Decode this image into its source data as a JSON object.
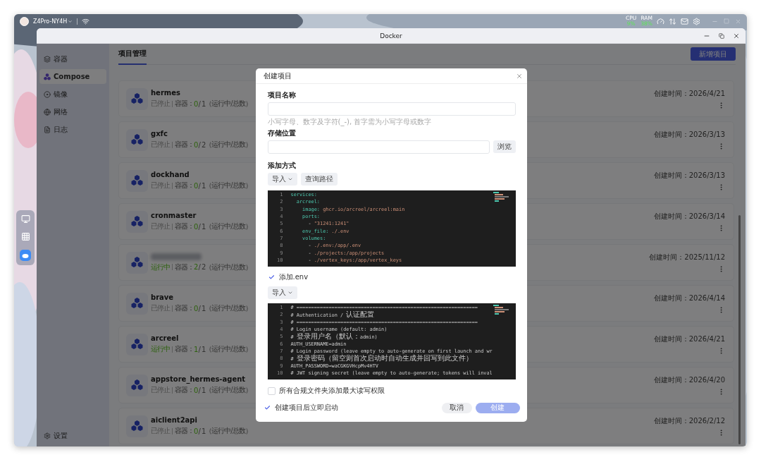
{
  "desktop": {
    "device": "Z4Pro-NY4H",
    "meters": [
      {
        "label": "CPU",
        "value": "9%"
      },
      {
        "label": "RAM",
        "value": "38%"
      }
    ]
  },
  "window": {
    "title": "Docker"
  },
  "sidebar": {
    "items": [
      {
        "label": "容器",
        "kind": "layers",
        "selected": false
      },
      {
        "label": "Compose",
        "kind": "compose",
        "selected": true
      },
      {
        "label": "镜像",
        "kind": "disc",
        "selected": false
      },
      {
        "label": "网络",
        "kind": "globe",
        "selected": false
      },
      {
        "label": "日志",
        "kind": "log",
        "selected": false
      }
    ],
    "footer": "设置"
  },
  "tabs": [
    {
      "label": "项目管理",
      "selected": true
    }
  ],
  "add_button": "新增项目",
  "projects": [
    {
      "name": "hermes",
      "redacted": false,
      "running": false,
      "status": "已停止",
      "containers_label": "容器：",
      "running_count": "0",
      "total": "/ 1",
      "note": "（运行中/总数）",
      "created": "创建时间：2026/4/21"
    },
    {
      "name": "gxfc",
      "redacted": false,
      "running": false,
      "status": "已停止",
      "containers_label": "容器：",
      "running_count": "0",
      "total": "/ 2",
      "note": "（运行中/总数）",
      "created": "创建时间：2026/3/13"
    },
    {
      "name": "dockhand",
      "redacted": false,
      "running": false,
      "status": "已停止",
      "containers_label": "容器：",
      "running_count": "0",
      "total": "/ 1",
      "note": "（运行中/总数）",
      "created": "创建时间：2026/3/13"
    },
    {
      "name": "cronmaster",
      "redacted": false,
      "running": false,
      "status": "已停止",
      "containers_label": "容器：",
      "running_count": "0",
      "total": "/ 1",
      "note": "（运行中/总数）",
      "created": "创建时间：2026/3/14"
    },
    {
      "redacted": true,
      "running": true,
      "status": "运行中",
      "containers_label": "容器：",
      "running_count": "2",
      "total": "/ 2",
      "note": "（运行中/总数）",
      "created": "创建时间：2025/11/12"
    },
    {
      "name": "brave",
      "redacted": false,
      "running": false,
      "status": "已停止",
      "containers_label": "容器：",
      "running_count": "0",
      "total": "/ 1",
      "note": "（运行中/总数）",
      "created": "创建时间：2026/4/14"
    },
    {
      "name": "arcreel",
      "redacted": false,
      "running": true,
      "status": "运行中",
      "containers_label": "容器：",
      "running_count": "1",
      "total": "/ 1",
      "note": "（运行中/总数）",
      "created": "创建时间：2026/4/21"
    },
    {
      "name": "appstore_hermes-agent",
      "redacted": false,
      "running": false,
      "status": "已停止",
      "containers_label": "容器：",
      "running_count": "0",
      "total": "/ 1",
      "note": "（运行中/总数）",
      "created": "创建时间：2026/4/20"
    },
    {
      "name": "aiclient2api",
      "redacted": false,
      "running": false,
      "status": "已停止",
      "containers_label": "容器：",
      "running_count": "0",
      "total": "/ 1",
      "note": "（运行中/总数）",
      "created": "创建时间：2026/2/12"
    }
  ],
  "dialog": {
    "title": "创建项目",
    "name_field": {
      "label": "项目名称",
      "hint": "小写字母、数字及字符(_-), 首字需为小写字母或数字"
    },
    "path_field": {
      "label": "存储位置",
      "button": "浏览"
    },
    "method": {
      "label": "添加方式",
      "import_button": "导入",
      "query_button": "查询路径"
    },
    "compose_lines": [
      {
        "no": "1",
        "parts": [
          {
            "kind": "key",
            "text": "services:"
          }
        ]
      },
      {
        "no": "2",
        "parts": [
          {
            "kind": "key",
            "text": "  arcreel:"
          }
        ]
      },
      {
        "no": "3",
        "parts": [
          {
            "kind": "key",
            "text": "    image:"
          },
          {
            "kind": "value",
            "text": " ghcr.io/arcreel/arcreel:main"
          }
        ]
      },
      {
        "no": "4",
        "parts": [
          {
            "kind": "key",
            "text": "    ports:"
          }
        ]
      },
      {
        "no": "5",
        "parts": [
          {
            "kind": "plain",
            "text": "      - "
          },
          {
            "kind": "value",
            "text": "\"31241:1241\""
          }
        ]
      },
      {
        "no": "6",
        "parts": [
          {
            "kind": "key",
            "text": "    env_file:"
          },
          {
            "kind": "value",
            "text": " ./.env"
          }
        ]
      },
      {
        "no": "7",
        "parts": [
          {
            "kind": "key",
            "text": "    volumes:"
          }
        ]
      },
      {
        "no": "8",
        "parts": [
          {
            "kind": "plain",
            "text": "      - "
          },
          {
            "kind": "value",
            "text": "./.env:/app/.env"
          }
        ]
      },
      {
        "no": "9",
        "parts": [
          {
            "kind": "plain",
            "text": "      - "
          },
          {
            "kind": "value",
            "text": "./projects:/app/projects"
          }
        ]
      },
      {
        "no": "10",
        "parts": [
          {
            "kind": "plain",
            "text": "      - "
          },
          {
            "kind": "value",
            "text": "./vertex_keys:/app/vertex_keys"
          }
        ]
      }
    ],
    "env": {
      "label": "添加.env",
      "checked": true,
      "import_button": "导入",
      "lines": [
        {
          "no": "1",
          "parts": [
            {
              "kind": "comment",
              "text": "# =============================================================="
            }
          ]
        },
        {
          "no": "2",
          "parts": [
            {
              "kind": "comment",
              "text": "# Authentication / 认证配置"
            }
          ]
        },
        {
          "no": "3",
          "parts": [
            {
              "kind": "comment",
              "text": "# =============================================================="
            }
          ]
        },
        {
          "no": "4",
          "parts": [
            {
              "kind": "comment",
              "text": "# Login username (default: admin)"
            }
          ]
        },
        {
          "no": "5",
          "parts": [
            {
              "kind": "comment",
              "text": "# 登录用户名（默认：admin)"
            }
          ]
        },
        {
          "no": "6",
          "parts": [
            {
              "kind": "plain",
              "text": "AUTH_USERNAME=admin"
            }
          ]
        },
        {
          "no": "7",
          "parts": [
            {
              "kind": "comment",
              "text": "# Login password (leave empty to auto-generate on first launch and wr"
            }
          ]
        },
        {
          "no": "8",
          "parts": [
            {
              "kind": "comment",
              "text": "# 登录密码（留空则首次启动时自动生成并回写到此文件）"
            }
          ]
        },
        {
          "no": "9",
          "parts": [
            {
              "kind": "plain",
              "text": "AUTH_PASSWORD=waCGKGVHcpMv4HTV"
            }
          ]
        },
        {
          "no": "10",
          "parts": [
            {
              "kind": "comment",
              "text": "# JWT signing secret (leave empty to auto-generate; tokens will inval"
            }
          ]
        }
      ]
    },
    "permissions": {
      "label": "所有合规文件夹添加最大读写权限",
      "checked": false
    },
    "autostart": {
      "label": "创建项目后立即启动",
      "checked": true
    },
    "cancel": "取消",
    "create": {
      "label": "创建",
      "disabled": true
    }
  }
}
